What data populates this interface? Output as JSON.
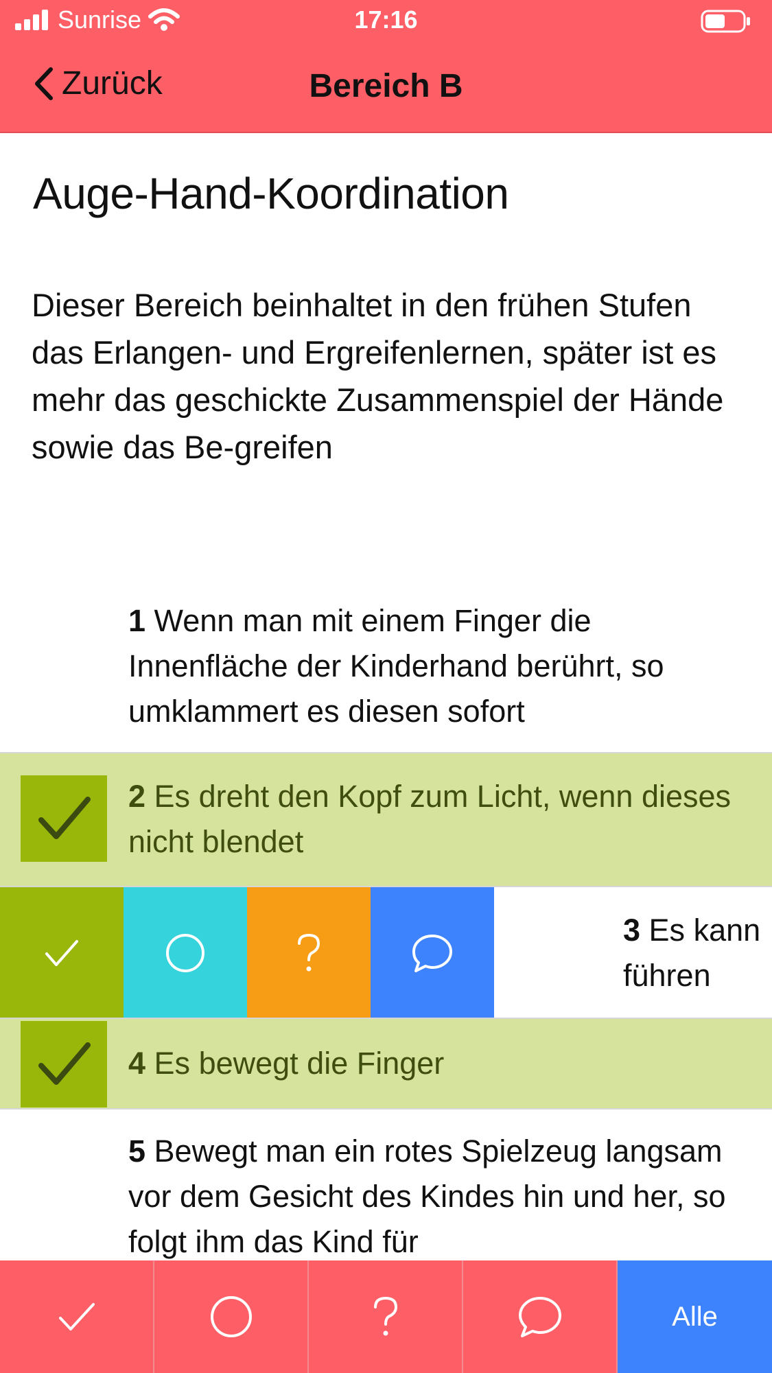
{
  "status_bar": {
    "carrier": "Sunrise",
    "time": "17:16"
  },
  "nav": {
    "back_label": "Zurück",
    "title": "Bereich B"
  },
  "heading": "Auge-Hand-Koordination",
  "description": "Dieser Bereich beinhaltet in den frühen Stufen das Erlangen- und Ergreifenlernen, später ist es mehr das geschickte Zusammenspiel der Hände sowie das Be-greifen",
  "items": [
    {
      "number": "1",
      "text": "Wenn man mit einem Finger die Innenfläche der Kinderhand berührt, so umklammert es diesen sofort",
      "checked": false
    },
    {
      "number": "2",
      "text": "Es dreht den Kopf zum Licht, wenn dieses nicht blendet",
      "checked": true
    },
    {
      "number": "3",
      "text": "Es kann",
      "text_line2": "führen",
      "checked": false
    },
    {
      "number": "4",
      "text": "Es bewegt die Finger",
      "checked": true
    },
    {
      "number": "5",
      "text": "Bewegt man ein rotes Spielzeug langsam vor dem Gesicht des Kindes hin und her, so folgt ihm das Kind für",
      "checked": false
    }
  ],
  "swipe_actions": [
    {
      "icon": "checkmark-icon",
      "color": "#99b70a"
    },
    {
      "icon": "circle-icon",
      "color": "#35d3dc"
    },
    {
      "icon": "question-icon",
      "color": "#f79c15"
    },
    {
      "icon": "comment-icon",
      "color": "#3d83fe"
    }
  ],
  "toolbar": {
    "items": [
      "checkmark-icon",
      "circle-icon",
      "question-icon",
      "comment-icon"
    ],
    "all_label": "Alle"
  },
  "colors": {
    "accent": "#fe5f67",
    "checked_bg": "#d6e39c",
    "check_green": "#99b70a",
    "cyan": "#35d3dc",
    "orange": "#f79c15",
    "blue": "#3d83fe"
  }
}
